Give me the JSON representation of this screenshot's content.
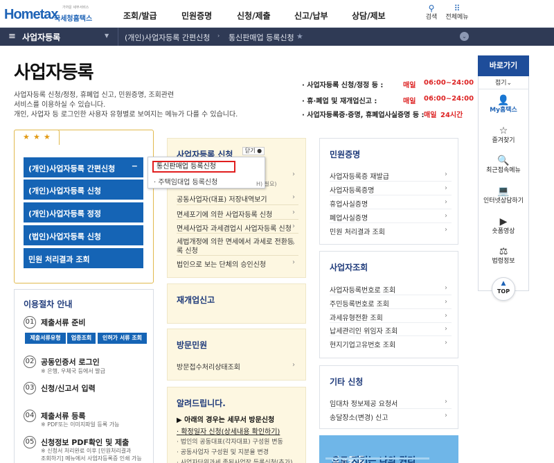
{
  "header": {
    "logo_main": "Hometax",
    "logo_sub": "국세청홈택스",
    "logo_tiny": "가까운 세무서비스",
    "nav": [
      "조회/발급",
      "민원증명",
      "신청/제출",
      "신고/납부",
      "상담/제보"
    ],
    "search_label": "검색",
    "menu_label": "전체메뉴"
  },
  "breadcrumb": {
    "current_menu": "사업자등록",
    "crumbs": [
      "(개인)사업자등록 간편신청",
      "통신판매업 등록신청"
    ]
  },
  "page": {
    "title": "사업자등록",
    "desc": [
      "사업자등록 신청/정정, 휴폐업 신고, 민원증명, 조회관련",
      "서비스를 이용하실 수 있습니다.",
      "개인, 사업자 등 로그인한 사용자 유형별로 보여지는 메뉴가 다를 수 있습니다."
    ],
    "hours": [
      {
        "label": "· 사업자등록 신청/정정 등 :",
        "prefix": "매일",
        "time": "06:00~24:00"
      },
      {
        "label": "· 휴·폐업 및 재개업신고 :",
        "prefix": "매일",
        "time": "06:00~24:00"
      },
      {
        "label": "· 사업자등록증·증명, 휴폐업사실증명 등 :",
        "prefix": "매일",
        "time": "24시간"
      }
    ]
  },
  "quick": {
    "stars": [
      "★",
      "★",
      "★"
    ],
    "buttons": [
      "(개인)사업자등록 간편신청",
      "(개인)사업자등록 신청",
      "(개인)사업자등록 정정",
      "(법인)사업자등록 신청",
      "민원 처리결과 조회"
    ],
    "minus": "−"
  },
  "popup": {
    "selected": "통신판매업 등록신청",
    "item": "· 주택임대업 등록신청",
    "trail": "H) 필요)"
  },
  "procedure": {
    "title": "이용절차 안내",
    "steps": [
      {
        "num": "01",
        "label": "제출서류 준비"
      },
      {
        "num": "02",
        "label": "공동인증서 로그인",
        "note": "※ 은행, 우체국 등에서 발급"
      },
      {
        "num": "03",
        "label": "신청/신고서 입력"
      },
      {
        "num": "04",
        "label": "제출서류 등록",
        "note": "※ PDF또는 이미지파일 등록 가능"
      },
      {
        "num": "05",
        "label": "신청정보 PDF확인 및 제출",
        "note1": "※ 신청서 처리완료 이후 [민원처리결과",
        "note2": "조회하기] 메뉴에서 사업자등록증 인쇄 가능"
      }
    ],
    "tags": [
      "제출서류유형",
      "업종조회",
      "인허가 서류 조회"
    ]
  },
  "middle": {
    "reg_title": "사업자등록 신청",
    "close_label": "닫기",
    "reg_items": [
      "공동사업자(대표) 저장내역보기",
      "면세포기에 의한 사업자등록 신청",
      "면세사업자 과세겸업시 사업자등록 신청",
      "세법개정에 의한 면세에서 과세로 전환등",
      "록 신청",
      "법인으로 보는 단체의 승인신청"
    ],
    "reopen_title": "재개업신고",
    "visit_title": "방문민원",
    "visit_item": "방문접수처리상태조회",
    "notice_title": "알려드립니다.",
    "notice_sub": "▶ 아래의 경우는 세무서 방문신청",
    "notice_items": [
      "· 확정일자 신청(상세내용 확인하기)",
      "· 법인의 공동대표(각자대표) 구성원 변동",
      "· 공동사업자 구성원 및 지분율 변경",
      "· 사업자단위과세 종된사업장 등록신청(추가)"
    ]
  },
  "right": {
    "cert_title": "민원증명",
    "cert_items": [
      "사업자등록증 재발급",
      "사업자등록증명",
      "휴업사실증명",
      "폐업사실증명",
      "민원 처리결과 조회"
    ],
    "inq_title": "사업자조회",
    "inq_items": [
      "사업자등록번호로 조회",
      "주민등록번호로 조회",
      "과세유형전환 조회",
      "납세관리인 위임자 조회",
      "현지기업고유번호 조회"
    ],
    "etc_title": "기타 신청",
    "etc_items": [
      "임대차 정보제공 요청서",
      "송달장소(변경) 신고"
    ],
    "banner_a": "상표등록",
    "banner_b": "으로 지키는 나의 권리"
  },
  "sidebar": {
    "title": "바로가기",
    "fold": "접기⌄",
    "items": [
      {
        "icon": "person-icon",
        "glyph": "👤",
        "label": "My홈택스"
      },
      {
        "icon": "star-icon",
        "glyph": "☆",
        "label": "즐겨찾기"
      },
      {
        "icon": "history-icon",
        "glyph": "🔍",
        "label": "최근접속메뉴"
      },
      {
        "icon": "laptop-icon",
        "glyph": "💻",
        "label": "인터넷상담하기"
      },
      {
        "icon": "video-icon",
        "glyph": "▶",
        "label": "숏폼영상"
      },
      {
        "icon": "gavel-icon",
        "glyph": "⚖",
        "label": "법령정보"
      }
    ],
    "top_label": "TOP"
  }
}
